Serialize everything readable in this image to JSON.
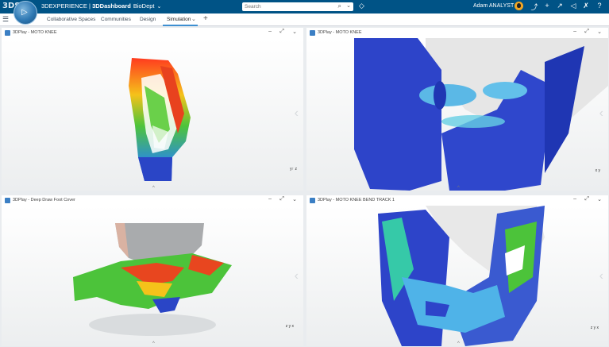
{
  "app": {
    "brand": "3DS",
    "compass_glyph": "▷",
    "title_prefix": "3DEXPERIENCE | ",
    "title_app": "3DDashboard",
    "tenant": "BioDept",
    "chevron": "⌄"
  },
  "search": {
    "placeholder": "Search",
    "icon": "⌕",
    "dropdown": "⌄"
  },
  "tag_icon_glyph": "◇",
  "user": {
    "name": "Adam ANALYST"
  },
  "toolbar_icons": {
    "share": "⤴",
    "add": "+",
    "forward": "↗",
    "share2": "◁",
    "tools": "✗",
    "help": "?"
  },
  "tabs": [
    {
      "label": "Collaborative Spaces"
    },
    {
      "label": "Communities"
    },
    {
      "label": "Design"
    },
    {
      "label": "Simulation"
    }
  ],
  "tab_chevron": "⌄",
  "tab_plus": "+",
  "hamburger": "☰",
  "panels": [
    {
      "title": "3DPlay - MOTO KNEE",
      "axes": "y↑ z"
    },
    {
      "title": "3DPlay - MOTO KNEE",
      "axes": "x y"
    },
    {
      "title": "3DPlay - Deep Draw Foot Cover",
      "axes": "z y x"
    },
    {
      "title": "3DPlay - MOTO KNEE BEND TRACK 1",
      "axes": "z y x"
    }
  ],
  "panel_controls": {
    "minimize": "–",
    "expand": "⤢",
    "menu": "⌄"
  },
  "side_arrow": "‹",
  "bottom_caret": "^",
  "colors": {
    "topbar": "#005386",
    "accent": "#3d8fd1"
  }
}
